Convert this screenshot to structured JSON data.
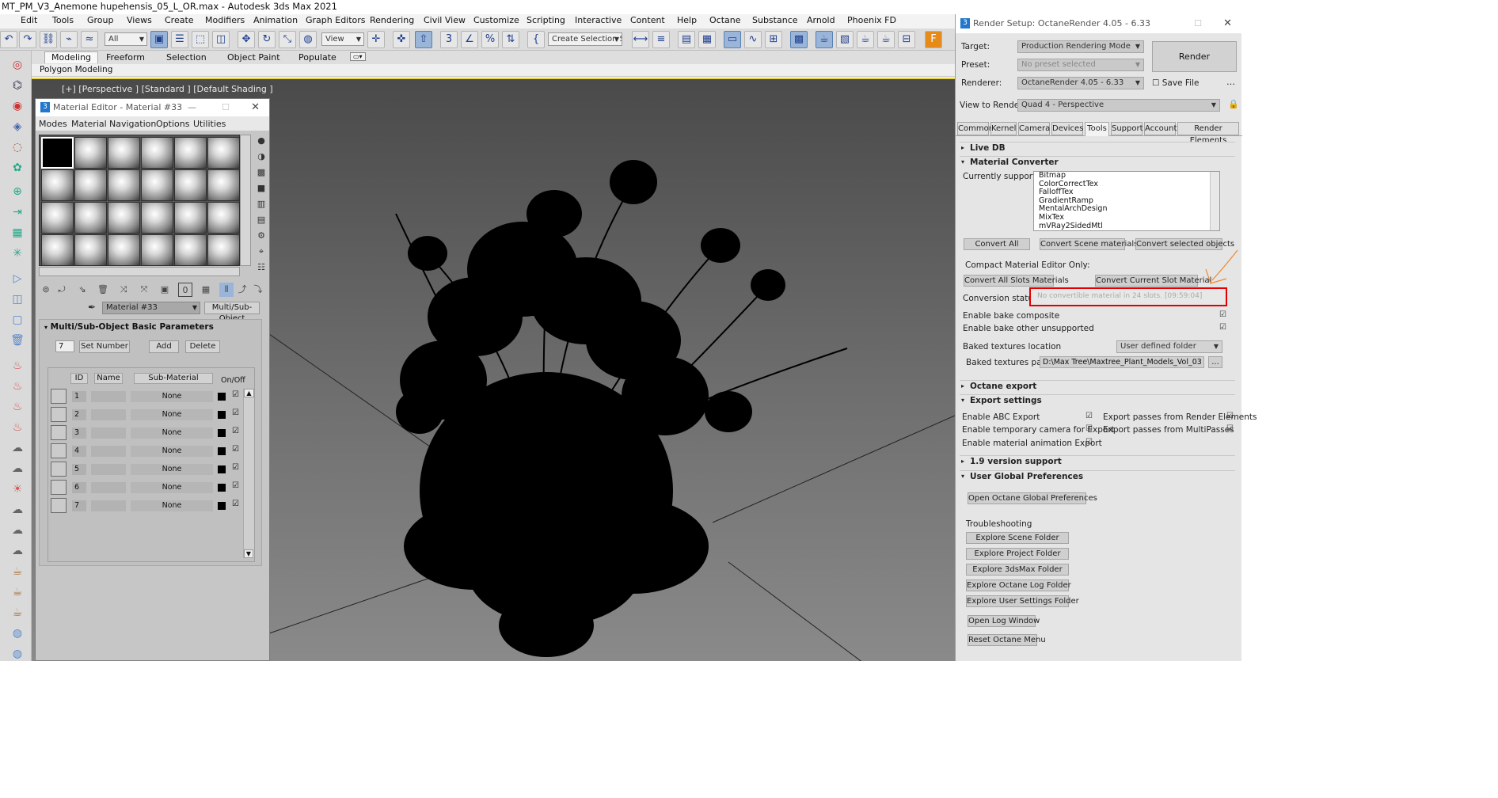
{
  "window": {
    "title": "MT_PM_V3_Anemone hupehensis_05_L_OR.max - Autodesk 3ds Max 2021"
  },
  "menu": [
    "Edit",
    "Tools",
    "Group",
    "Views",
    "Create",
    "Modifiers",
    "Animation",
    "Graph Editors",
    "Rendering",
    "Civil View",
    "Customize",
    "Scripting",
    "Interactive",
    "Content",
    "Help",
    "Octane",
    "Substance",
    "Arnold",
    "Phoenix FD"
  ],
  "toolbar": {
    "selection_filter": "All",
    "ref_coord": "View",
    "named_selection": "Create Selection Se"
  },
  "ribbon": {
    "tabs": [
      "Modeling",
      "Freeform",
      "Selection",
      "Object Paint",
      "Populate"
    ],
    "active": "Modeling",
    "sub": "Polygon Modeling"
  },
  "viewport": {
    "label": "[+] [Perspective ] [Standard ] [Default Shading ]"
  },
  "material_editor": {
    "title": "Material Editor - Material #33",
    "menu": [
      "Modes",
      "Material",
      "Navigation",
      "Options",
      "Utilities"
    ],
    "material_name": "Material #33",
    "material_type": "Multi/Sub-Object",
    "rollout_title": "Multi/Sub-Object Basic Parameters",
    "num_materials": "7",
    "set_number": "Set Number",
    "add": "Add",
    "delete": "Delete",
    "headers": {
      "id": "ID",
      "name": "Name",
      "sub": "Sub-Material",
      "onoff": "On/Off"
    },
    "rows": [
      {
        "id": "1",
        "sub": "None"
      },
      {
        "id": "2",
        "sub": "None"
      },
      {
        "id": "3",
        "sub": "None"
      },
      {
        "id": "4",
        "sub": "None"
      },
      {
        "id": "5",
        "sub": "None"
      },
      {
        "id": "6",
        "sub": "None"
      },
      {
        "id": "7",
        "sub": "None"
      }
    ]
  },
  "render_setup": {
    "title": "Render Setup: OctaneRender 4.05 - 6.33",
    "target_label": "Target:",
    "target": "Production Rendering Mode",
    "preset_label": "Preset:",
    "preset": "No preset selected",
    "renderer_label": "Renderer:",
    "renderer": "OctaneRender 4.05 - 6.33",
    "save_file": "Save File",
    "view_label": "View to Render:",
    "view": "Quad 4 - Perspective",
    "render_btn": "Render",
    "tabs": [
      "Common",
      "Kernel",
      "Camera",
      "Devices",
      "Tools",
      "Support",
      "Account",
      "Render Elements"
    ],
    "active_tab": "Tools",
    "live_db": "Live DB",
    "mat_conv": "Material Converter",
    "supported_label": "Currently supported:",
    "supported": [
      "Bitmap",
      "ColorCorrectTex",
      "FalloffTex",
      "GradientRamp",
      "MentalArchDesign",
      "MixTex",
      "mVRay2SidedMtl"
    ],
    "convert_all": "Convert All",
    "convert_scene": "Convert Scene materials",
    "convert_selected": "Convert selected objects",
    "compact_only": "Compact Material Editor Only:",
    "convert_all_slots": "Convert All Slots Materials",
    "convert_current": "Convert Current Slot Material",
    "status_label": "Conversion status:",
    "status_value": "No convertible material in 24 slots. [09:59:04]",
    "bake_composite": "Enable bake composite",
    "bake_other": "Enable bake other unsupported",
    "baked_loc_label": "Baked textures location",
    "baked_loc": "User defined folder",
    "baked_path_label": "Baked textures path",
    "baked_path": "D:\\Max Tree\\Maxtree_Plant_Models_Vol_03",
    "browse": "...",
    "octane_export": "Octane export",
    "export_settings": "Export settings",
    "abc": "Enable ABC Export",
    "temp_cam": "Enable temporary camera for Export",
    "mat_anim": "Enable material animation Export",
    "passes_re": "Export passes from Render Elements",
    "passes_mp": "Export passes from MultiPasses",
    "v19": "1.9 version support",
    "ugp": "User Global Preferences",
    "open_prefs": "Open Octane Global Preferences",
    "troubleshooting": "Troubleshooting",
    "explore_scene": "Explore Scene Folder",
    "explore_project": "Explore Project Folder",
    "explore_max": "Explore 3dsMax Folder",
    "explore_log": "Explore Octane Log Folder",
    "explore_user": "Explore User Settings Folder",
    "open_log": "Open Log Window",
    "reset_menu": "Reset Octane Menu"
  },
  "colors": {
    "highlight_box": "#e20000",
    "annotation_arrow": "#f08a2a",
    "viewport_border": "#e6d34e"
  }
}
